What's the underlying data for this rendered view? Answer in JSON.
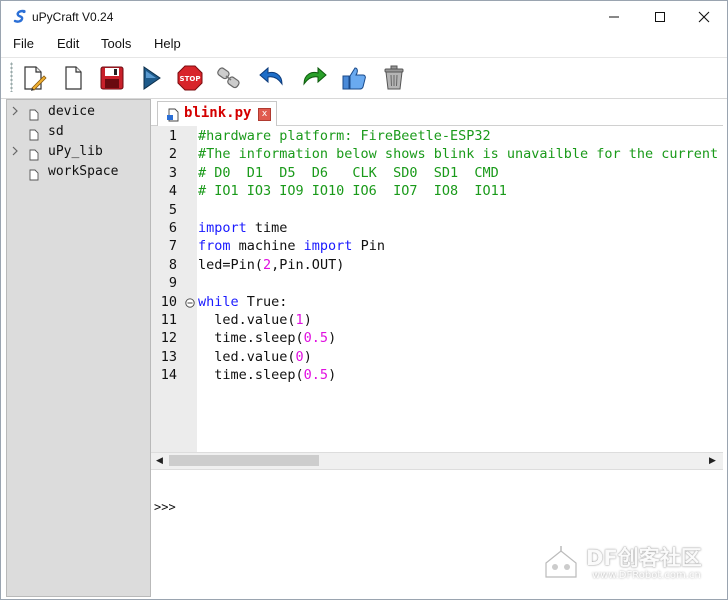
{
  "window": {
    "title": "uPyCraft V0.24",
    "controls": {
      "minimize": "—",
      "maximize": "☐",
      "close": "✕"
    }
  },
  "menu": {
    "items": [
      {
        "label": "File"
      },
      {
        "label": "Edit"
      },
      {
        "label": "Tools"
      },
      {
        "label": "Help"
      }
    ]
  },
  "toolbar": {
    "buttons": [
      {
        "icon": "new-file-icon"
      },
      {
        "icon": "open-file-icon"
      },
      {
        "icon": "save-icon"
      },
      {
        "icon": "run-icon"
      },
      {
        "icon": "stop-icon",
        "text": "STOP"
      },
      {
        "icon": "connect-icon"
      },
      {
        "icon": "undo-icon"
      },
      {
        "icon": "redo-icon"
      },
      {
        "icon": "thumbs-up-icon"
      },
      {
        "icon": "trash-icon"
      }
    ]
  },
  "sidebar": {
    "items": [
      {
        "label": "device",
        "expandable": true
      },
      {
        "label": "sd",
        "expandable": false
      },
      {
        "label": "uPy_lib",
        "expandable": true
      },
      {
        "label": "workSpace",
        "expandable": false
      }
    ]
  },
  "editor": {
    "tab": {
      "label": "blink.py",
      "close": "x"
    },
    "line_numbers": [
      "1",
      "2",
      "3",
      "4",
      "5",
      "6",
      "7",
      "8",
      "9",
      "10",
      "11",
      "12",
      "13",
      "14"
    ],
    "lines": [
      [
        {
          "t": "#hardware platform: FireBeetle-ESP32",
          "c": "com"
        }
      ],
      [
        {
          "t": "#The information below shows blink is unavailble for the current version.",
          "c": "com"
        }
      ],
      [
        {
          "t": "# D0  D1  D5  D6   CLK  SD0  SD1  CMD",
          "c": "com"
        }
      ],
      [
        {
          "t": "# IO1 IO3 IO9 IO10 IO6  IO7  IO8  IO11",
          "c": "com"
        }
      ],
      [
        {
          "t": "",
          "c": "txt"
        }
      ],
      [
        {
          "t": "import",
          "c": "kw"
        },
        {
          "t": " time",
          "c": "txt"
        }
      ],
      [
        {
          "t": "from",
          "c": "kw"
        },
        {
          "t": " machine ",
          "c": "txt"
        },
        {
          "t": "import",
          "c": "kw"
        },
        {
          "t": " Pin",
          "c": "txt"
        }
      ],
      [
        {
          "t": "led=Pin(",
          "c": "txt"
        },
        {
          "t": "2",
          "c": "num"
        },
        {
          "t": ",Pin.OUT)",
          "c": "txt"
        }
      ],
      [
        {
          "t": "",
          "c": "txt"
        }
      ],
      [
        {
          "t": "while",
          "c": "kw"
        },
        {
          "t": " True:",
          "c": "txt"
        }
      ],
      [
        {
          "t": "  led.value(",
          "c": "txt"
        },
        {
          "t": "1",
          "c": "num"
        },
        {
          "t": ")",
          "c": "txt"
        }
      ],
      [
        {
          "t": "  time.sleep(",
          "c": "txt"
        },
        {
          "t": "0.5",
          "c": "num"
        },
        {
          "t": ")",
          "c": "txt"
        }
      ],
      [
        {
          "t": "  led.value(",
          "c": "txt"
        },
        {
          "t": "0",
          "c": "num"
        },
        {
          "t": ")",
          "c": "txt"
        }
      ],
      [
        {
          "t": "  time.sleep(",
          "c": "txt"
        },
        {
          "t": "0.5",
          "c": "num"
        },
        {
          "t": ")",
          "c": "txt"
        }
      ]
    ],
    "fold_line": 10
  },
  "console": {
    "prompt": ">>>"
  },
  "watermark": {
    "title": "DF创客社区",
    "url": "www.DFRobot.com.cn"
  },
  "colors": {
    "comment": "#1a9a1a",
    "keyword": "#1a1aff",
    "number": "#e010e0",
    "tab_text": "#d40000",
    "sidebar_bg": "#dcdcdc"
  }
}
